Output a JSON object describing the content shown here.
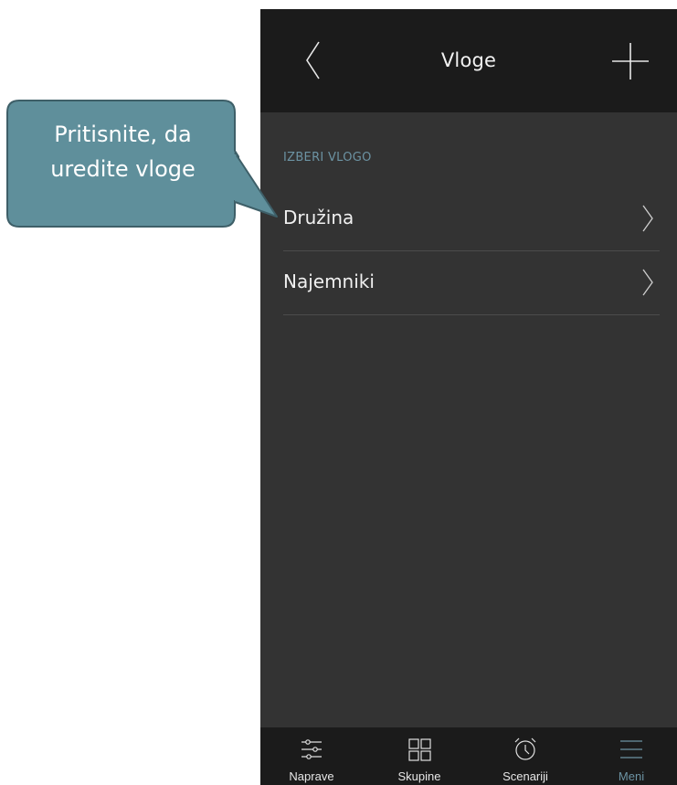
{
  "header": {
    "title": "Vloge",
    "back_icon": "chevron-left-icon",
    "add_icon": "plus-icon"
  },
  "section_label": "IZBERI VLOGO",
  "roles": [
    {
      "label": "Družina"
    },
    {
      "label": "Najemniki"
    }
  ],
  "tabbar": {
    "tabs": [
      {
        "label": "Naprave",
        "icon": "sliders-icon",
        "active": false
      },
      {
        "label": "Skupine",
        "icon": "grid-icon",
        "active": false
      },
      {
        "label": "Scenariji",
        "icon": "alarm-clock-icon",
        "active": false
      },
      {
        "label": "Meni",
        "icon": "menu-icon",
        "active": true
      }
    ]
  },
  "callout": {
    "line1": "Pritisnite, da",
    "line2": "uredite vloge"
  },
  "colors": {
    "header_bg": "#1b1b1b",
    "content_bg": "#333333",
    "accent": "#6c93a3",
    "callout_fill": "#5f8f9b",
    "callout_border": "#3e5f68"
  }
}
